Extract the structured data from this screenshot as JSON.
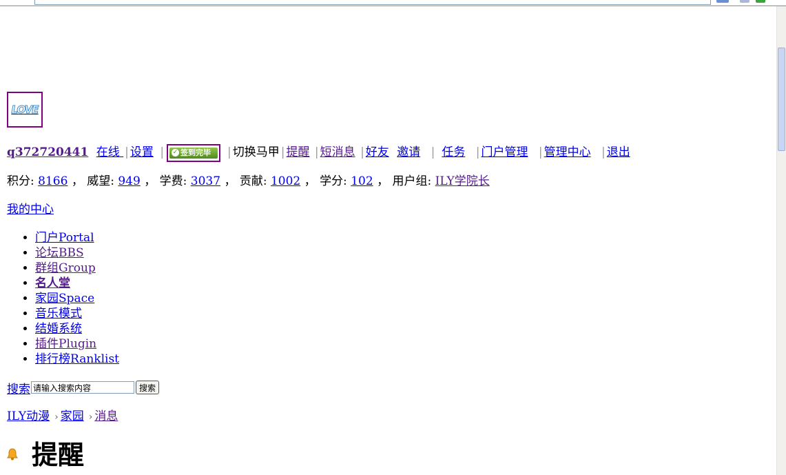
{
  "logo": {
    "text": "LOVE"
  },
  "userbar": {
    "username": "q372720441",
    "online": "在线",
    "settings": "设置",
    "signin_badge": "签到完毕",
    "switch_account": "切换马甲",
    "reminders": "提醒",
    "messages": "短消息",
    "friends": "好友",
    "invite": "邀请",
    "tasks": "任务",
    "portal_admin": "门户管理",
    "admin_center": "管理中心",
    "logout": "退出"
  },
  "stats": {
    "points_label": "积分:",
    "points": "8166",
    "prestige_label": "威望:",
    "prestige": "949",
    "tuition_label": "学费:",
    "tuition": "3037",
    "contribution_label": "贡献:",
    "contribution": "1002",
    "credits_label": "学分:",
    "credits": "102",
    "group_label": "用户组:",
    "group": "ILY学院长",
    "comma": "，"
  },
  "my_center": "我的中心",
  "nav": [
    {
      "label": "门户Portal"
    },
    {
      "label": "论坛BBS"
    },
    {
      "label": "群组Group"
    },
    {
      "label": "名人堂"
    },
    {
      "label": "家园Space"
    },
    {
      "label": "音乐模式"
    },
    {
      "label": "结婚系统"
    },
    {
      "label": "插件Plugin"
    },
    {
      "label": "排行榜Ranklist"
    }
  ],
  "search": {
    "label": "搜索",
    "value": "请输入搜索内容",
    "button": "搜索"
  },
  "breadcrumb": {
    "arrow": "›",
    "items": [
      "ILY动漫",
      "家园",
      "消息"
    ]
  },
  "page_title": "提醒",
  "colors": {
    "link": "#0000ee",
    "visited": "#551a8b",
    "badge_border": "#800080",
    "badge_green": "#4f8a1e"
  }
}
